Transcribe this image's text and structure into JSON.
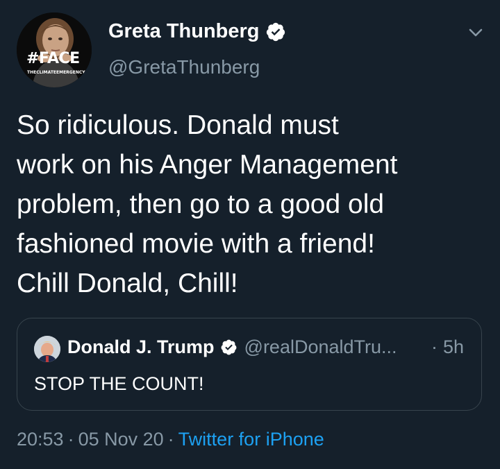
{
  "colors": {
    "background": "#15202b",
    "primary_text": "#ffffff",
    "secondary_text": "#8899a6",
    "accent": "#1da1f2",
    "border": "#38444d"
  },
  "author": {
    "display_name": "Greta Thunberg",
    "handle": "@GretaThunberg",
    "verified": true,
    "avatar_icon": "profile-photo-avatar",
    "avatar_hashtag": "#FACE",
    "avatar_subtag": "THECLIMATEEMERGENCY"
  },
  "tweet": {
    "text": "So ridiculous. Donald must\nwork on his Anger Management\nproblem, then go to a good old\nfashioned movie with a friend!\nChill Donald, Chill!",
    "time": "20:53",
    "date": "05 Nov 20",
    "separator": "·",
    "source": "Twitter for iPhone"
  },
  "quoted_tweet": {
    "display_name": "Donald J. Trump",
    "handle": "@realDonaldTru...",
    "verified": true,
    "separator": "·",
    "age": "5h",
    "text": "STOP THE COUNT!"
  },
  "icons": {
    "menu": "chevron-down-icon",
    "verified": "verified-badge-icon"
  }
}
